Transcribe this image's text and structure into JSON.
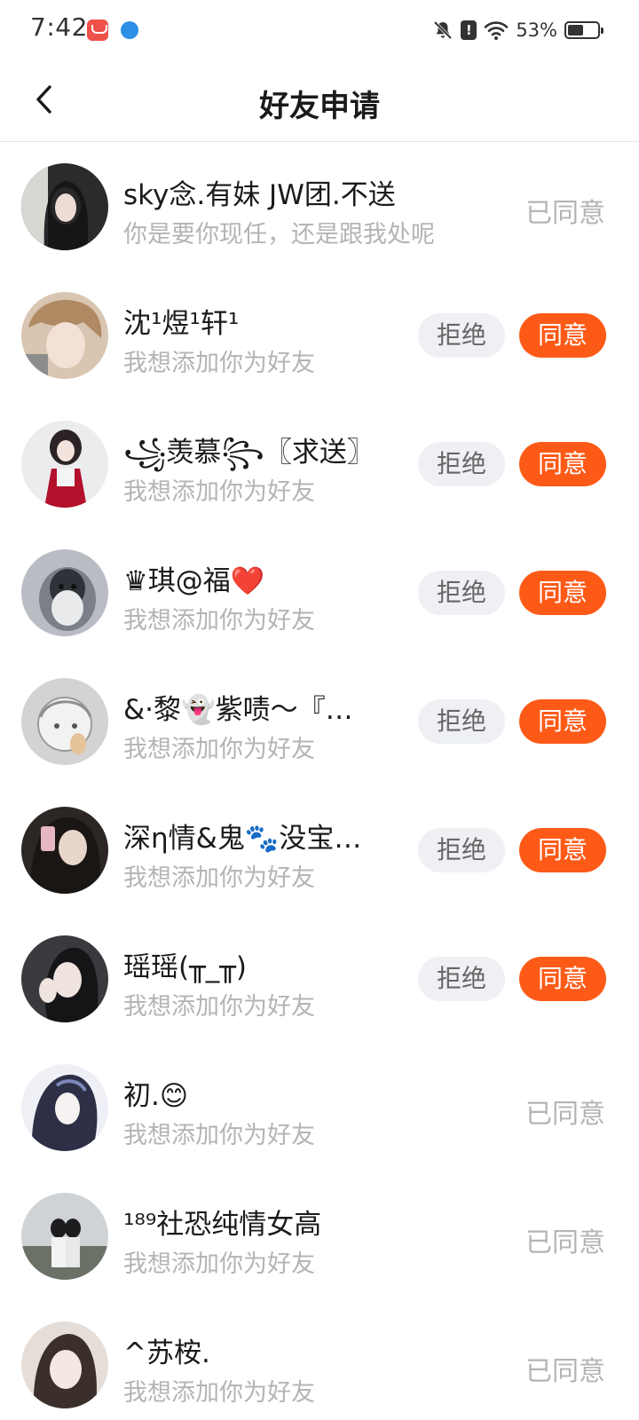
{
  "status_bar": {
    "time": "7:42",
    "battery_percent": "53%",
    "battery_level": 0.53,
    "icons": [
      "shopping-bag-app-icon",
      "browser-app-icon",
      "bell-off-icon",
      "alert-icon",
      "wifi-icon",
      "battery-icon"
    ]
  },
  "header": {
    "title": "好友申请",
    "back_icon": "chevron-left-icon"
  },
  "colors": {
    "accent": "#fd5a17",
    "reject_bg": "#eef0f4",
    "muted_text": "#b4b4b4"
  },
  "buttons": {
    "reject_label": "拒绝",
    "accept_label": "同意",
    "accepted_label": "已同意"
  },
  "requests": [
    {
      "name": "sky念.有妹 JW团.不送",
      "message": "你是要你现任，还是跟我处呢",
      "status": "accepted"
    },
    {
      "name": "沈¹煜¹轩¹",
      "message": "我想添加你为好友",
      "status": "pending"
    },
    {
      "name": "꧁羡慕꧂〖求送〗",
      "message": "我想添加你为好友",
      "status": "pending"
    },
    {
      "name": "♛琪@福❤️",
      "message": "我想添加你为好友",
      "status": "pending"
    },
    {
      "name": "&·黎👻紫啧～『…",
      "message": "我想添加你为好友",
      "status": "pending"
    },
    {
      "name": "深η情&鬼🐾没宝…",
      "message": "我想添加你为好友",
      "status": "pending"
    },
    {
      "name": "瑶瑶(╥_╥)",
      "message": "我想添加你为好友",
      "status": "pending"
    },
    {
      "name": "初.😊",
      "message": "我想添加你为好友",
      "status": "accepted"
    },
    {
      "name": "¹⁸⁹社恐纯情女高",
      "message": "我想添加你为好友",
      "status": "accepted"
    },
    {
      "name": "^苏桉.",
      "message": "我想添加你为好友",
      "status": "accepted"
    }
  ]
}
